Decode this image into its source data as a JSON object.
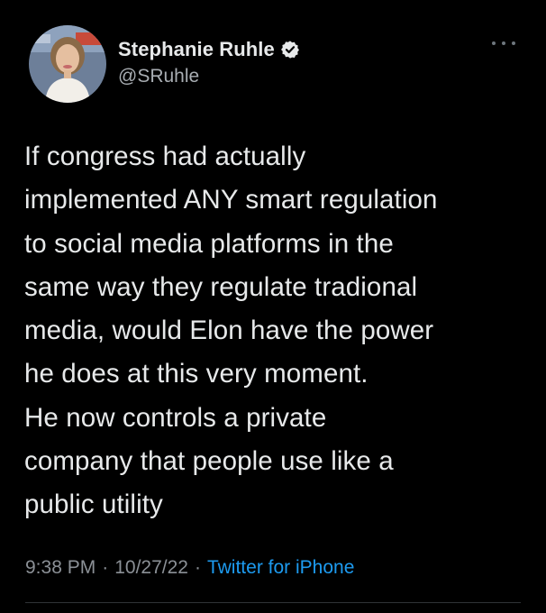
{
  "author": {
    "display_name": "Stephanie Ruhle",
    "handle": "@SRuhle",
    "verified": true
  },
  "tweet": {
    "text": "If congress had actually\nimplemented ANY smart regulation\nto social media platforms in the\nsame way they regulate tradional\nmedia, would Elon have the power\nhe does at this very moment.\nHe now controls a private\ncompany that people use like a\npublic utility",
    "time": "9:38 PM",
    "date": "10/27/22",
    "separator": "·",
    "source": "Twitter for iPhone"
  },
  "colors": {
    "background": "#000000",
    "text": "#e7e9ea",
    "secondary_text": "#8b9096",
    "link": "#1d9bf0",
    "verified_badge": "#e7e9ea"
  },
  "icons": {
    "verified": "verified-badge-icon",
    "more": "more-options-icon"
  }
}
